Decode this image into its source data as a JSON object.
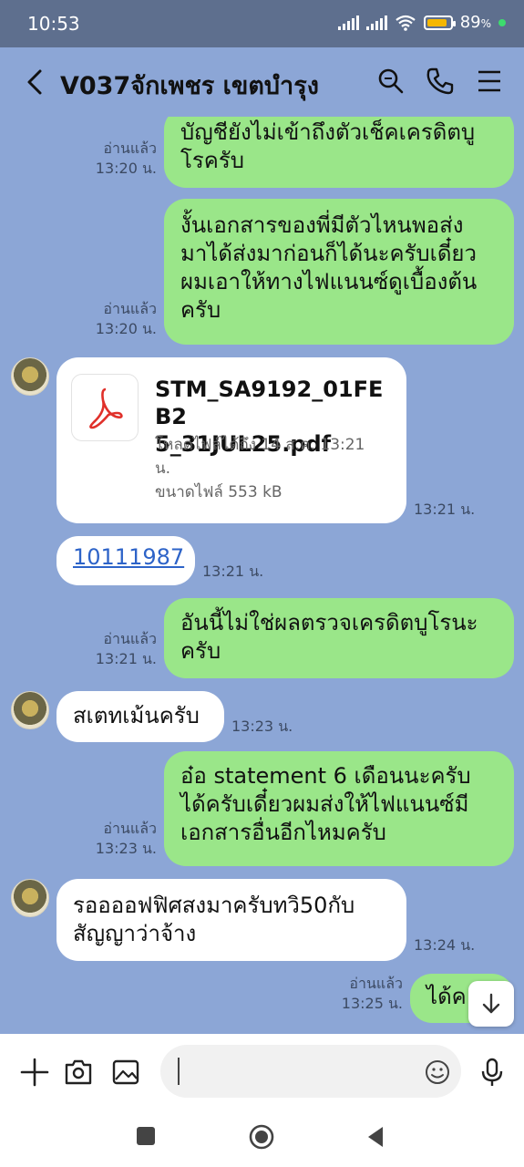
{
  "status_bar": {
    "time": "10:53",
    "battery_percent": "89",
    "battery_suffix": "%",
    "battery_level": 0.89,
    "accent": "#f5b700"
  },
  "header": {
    "title": "V037จักเพชร เขตบำรุง",
    "icons": [
      "back-icon",
      "search-icon",
      "phone-icon",
      "menu-icon"
    ]
  },
  "messages": [
    {
      "dir": "out",
      "read": "อ่านแล้ว",
      "time": "13:20 น.",
      "lines": [
        "บัญชียังไม่เข้าถึงตัวเช็คเครดิตบู",
        "โรครับ"
      ]
    },
    {
      "dir": "out",
      "read": "อ่านแล้ว",
      "time": "13:20 น.",
      "lines": [
        "งั้นเอกสารของพี่มีตัวไหนพอส่ง",
        "มาได้ส่งมาก่อนก็ได้นะครับเดี๋ยว",
        "ผมเอาให้ทางไฟแนนซ์ดูเบื้องต้น",
        "ครับ"
      ]
    },
    {
      "dir": "in",
      "type": "file",
      "file_name": "STM_SA9192_01FEB25_31JUL25.pdf",
      "file_name_lines": [
        "STM_SA9192_01FEB2",
        "5_31JUL25.pdf"
      ],
      "download_line1": "โหลดไฟล์ได้ถึง 14 ส.ค. 13:21",
      "download_line2": "น.",
      "size": "ขนาดไฟล์ 553 kB",
      "time": "13:21 น."
    },
    {
      "dir": "in",
      "type": "link",
      "text": "10111987",
      "time": "13:21 น."
    },
    {
      "dir": "out",
      "read": "อ่านแล้ว",
      "time": "13:21 น.",
      "lines": [
        "อันนี้ไม่ใช่ผลตรวจเครดิตบูโรนะ",
        "ครับ"
      ]
    },
    {
      "dir": "in",
      "text": "สเตทเม้นครับ",
      "time": "13:23 น."
    },
    {
      "dir": "out",
      "read": "อ่านแล้ว",
      "time": "13:23 น.",
      "lines": [
        "อ๋อ statement 6 เดือนนะครับ",
        "ได้ครับเดี๋ยวผมส่งให้ไฟแนนซ์มี",
        "เอกสารอื่นอีกไหมครับ"
      ]
    },
    {
      "dir": "in",
      "time": "13:24 น.",
      "lines": [
        "รออออฟฟิศสงมาครับทวิ50กับ",
        "สัญญาว่าจ้าง"
      ]
    },
    {
      "dir": "out",
      "read": "อ่านแล้ว",
      "time": "13:25 น.",
      "text": "ได้ค"
    }
  ],
  "input_bar": {
    "placeholder": "",
    "icons": [
      "plus-icon",
      "camera-icon",
      "image-icon",
      "emoji-icon",
      "mic-icon"
    ]
  },
  "nav_bar": {
    "icons": [
      "recents-icon",
      "home-icon",
      "back-nav-icon"
    ]
  }
}
